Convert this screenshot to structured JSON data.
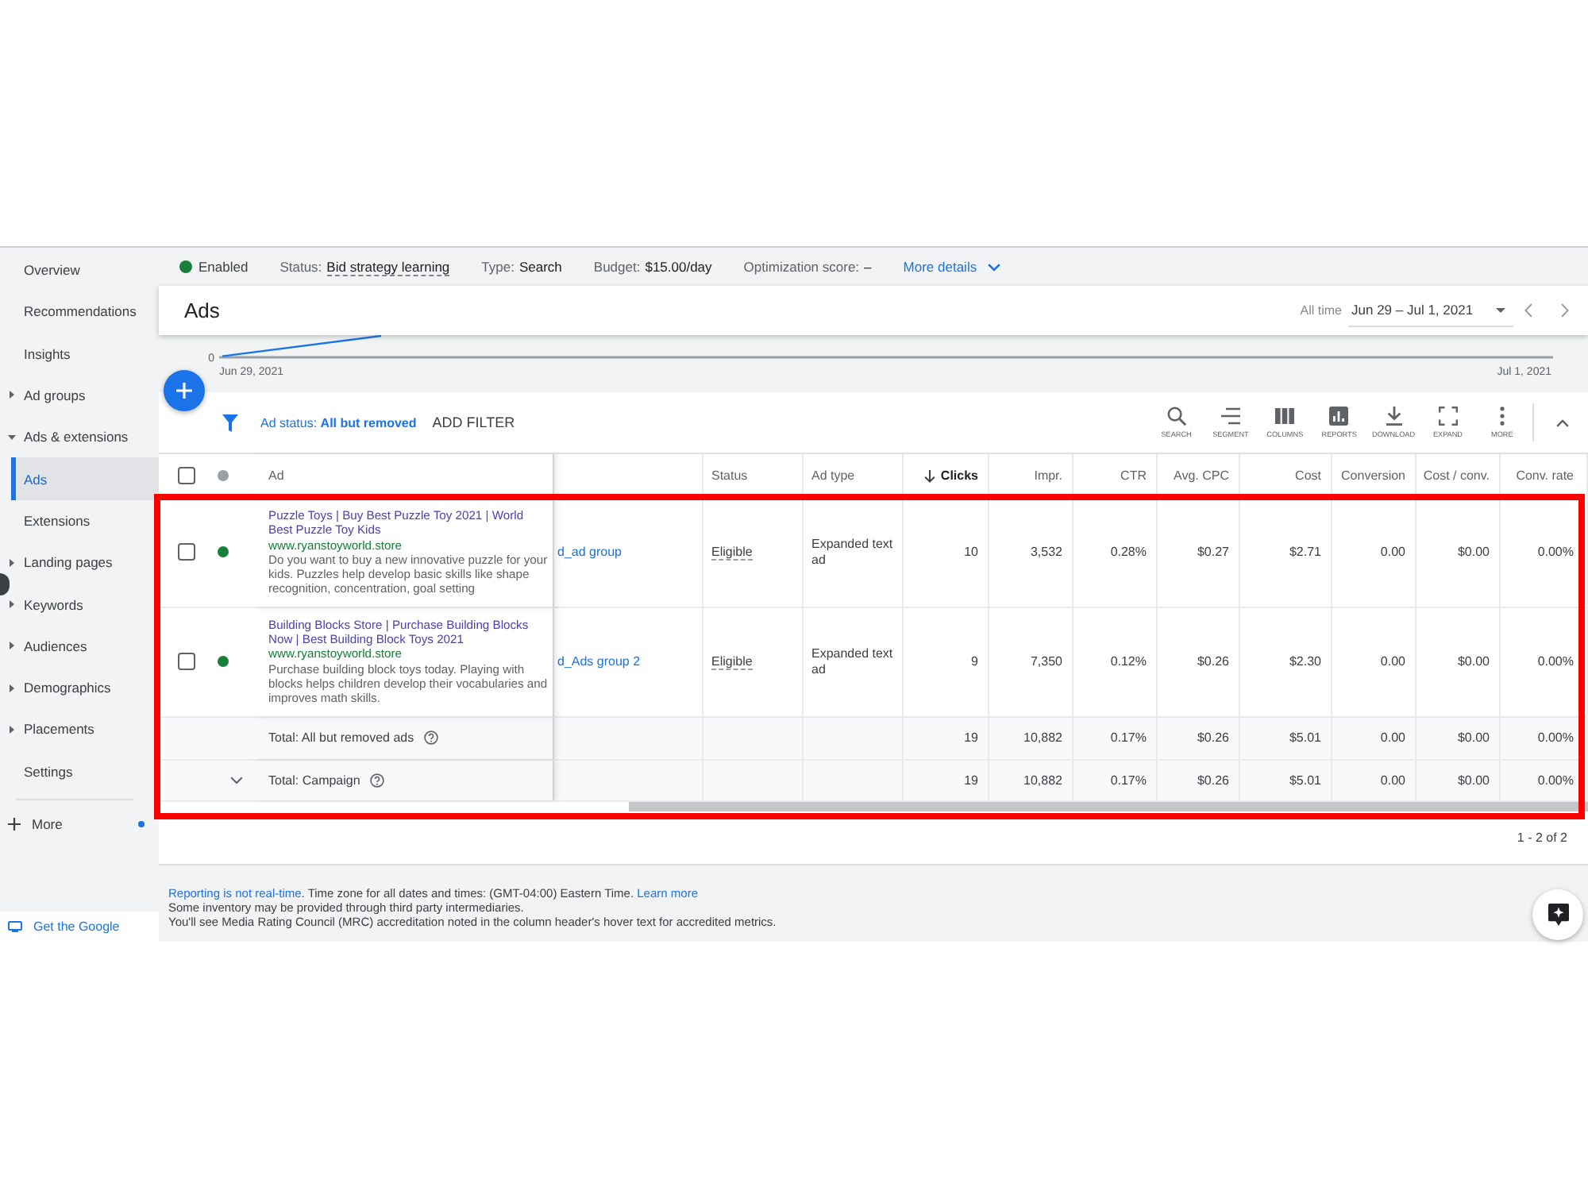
{
  "status_bar": {
    "items": [
      {
        "kind": "state",
        "label": "Enabled",
        "color": "#188038"
      },
      {
        "kind": "field",
        "label": "Status:",
        "value": "Bid strategy learning",
        "has_tooltip": true
      },
      {
        "kind": "field",
        "label": "Type:",
        "value": "Search",
        "has_tooltip": false
      },
      {
        "kind": "field",
        "label": "Budget:",
        "value": "$15.00/day",
        "has_tooltip": false
      },
      {
        "kind": "field",
        "label": "Optimization score:",
        "value": "–",
        "has_tooltip": false
      },
      {
        "kind": "link",
        "label": "More details"
      }
    ]
  },
  "sidebar": {
    "items": [
      {
        "label": "Overview",
        "kind": "page",
        "expanded": false,
        "selected": false
      },
      {
        "label": "Recommendations",
        "kind": "page",
        "expanded": false,
        "selected": false
      },
      {
        "label": "Insights",
        "kind": "page",
        "expanded": false,
        "selected": false
      },
      {
        "label": "Ad groups",
        "kind": "section",
        "expanded": false,
        "selected": false
      },
      {
        "label": "Ads & extensions",
        "kind": "section",
        "expanded": true,
        "selected": false,
        "children": [
          {
            "label": "Ads",
            "kind": "page",
            "expanded": false,
            "selected": true
          },
          {
            "label": "Extensions",
            "kind": "page",
            "expanded": false,
            "selected": false
          }
        ]
      },
      {
        "label": "Landing pages",
        "kind": "section",
        "expanded": false,
        "selected": false
      },
      {
        "label": "Keywords",
        "kind": "section",
        "expanded": false,
        "selected": false
      },
      {
        "label": "Audiences",
        "kind": "section",
        "expanded": false,
        "selected": false
      },
      {
        "label": "Demographics",
        "kind": "section",
        "expanded": false,
        "selected": false
      },
      {
        "label": "Placements",
        "kind": "section",
        "expanded": false,
        "selected": false
      },
      {
        "label": "Settings",
        "kind": "page",
        "expanded": false,
        "selected": false
      }
    ],
    "more": {
      "label": "More",
      "notification": true
    },
    "promo": {
      "label": "Get the Google"
    }
  },
  "page_header": {
    "title": "Ads",
    "date_preset": "All time",
    "date_range": "Jun 29 – Jul 1, 2021"
  },
  "chart": {
    "y_tick": "0",
    "start_label": "Jun 29, 2021",
    "end_label": "Jul 1, 2021"
  },
  "toolbar": {
    "filter": "Ad status: **All but removed**",
    "add_filter": "ADD FILTER",
    "tools": [
      {
        "kind": "search",
        "label": "SEARCH"
      },
      {
        "kind": "segment",
        "label": "SEGMENT"
      },
      {
        "kind": "columns",
        "label": "COLUMNS"
      },
      {
        "kind": "reports",
        "label": "REPORTS"
      },
      {
        "kind": "download",
        "label": "DOWNLOAD"
      },
      {
        "kind": "expand",
        "label": "EXPAND"
      },
      {
        "kind": "more",
        "label": "MORE"
      }
    ]
  },
  "table": {
    "header": {
      "checked": false,
      "ad": "Ad",
      "status": "Status",
      "ad_type": "Ad type",
      "metrics": [
        {
          "label": "Clicks",
          "sorted": true
        },
        {
          "label": "Impr.",
          "sorted": false
        },
        {
          "label": "CTR",
          "sorted": false
        },
        {
          "label": "Avg. CPC",
          "sorted": false
        },
        {
          "label": "Cost",
          "sorted": false
        },
        {
          "label": "Conversion",
          "sorted": false
        },
        {
          "label": "Cost / conv.",
          "sorted": false
        },
        {
          "label": "Conv. rate",
          "sorted": false
        }
      ]
    },
    "rows": [
      {
        "checked": false,
        "color": "#188038",
        "headline": "Puzzle Toys | Buy Best Puzzle Toy 2021 | World Best Puzzle Toy Kids",
        "url": "www.ryanstoyworld.store",
        "description": "Do you want to buy a new innovative puzzle for your kids. Puzzles help develop basic skills like shape recognition, concentration, goal setting",
        "column_2": "d_ad group",
        "status": "Eligible",
        "ad_type": "Expanded text ad",
        "metrics": [
          "10",
          "3,532",
          "0.28%",
          "$0.27",
          "$2.71",
          "0.00",
          "$0.00",
          "0.00%"
        ]
      },
      {
        "checked": false,
        "color": "#188038",
        "headline": "Building Blocks Store | Purchase Building Blocks Now | Best Building Block Toys 2021",
        "url": "www.ryanstoyworld.store",
        "description": "Purchase building block toys today. Playing with blocks helps children develop their vocabularies and improves math skills.",
        "column_2": "d_Ads group 2",
        "status": "Eligible",
        "ad_type": "Expanded text ad",
        "metrics": [
          "9",
          "7,350",
          "0.12%",
          "$0.26",
          "$2.30",
          "0.00",
          "$0.00",
          "0.00%"
        ]
      }
    ],
    "totals": [
      {
        "label": "Total: All but removed ads",
        "expandable": false,
        "metrics": [
          "19",
          "10,882",
          "0.17%",
          "$0.26",
          "$5.01",
          "0.00",
          "$0.00",
          "0.00%"
        ]
      },
      {
        "label": "Total: Campaign",
        "expandable": true,
        "metrics": [
          "19",
          "10,882",
          "0.17%",
          "$0.26",
          "$5.01",
          "0.00",
          "$0.00",
          "0.00%"
        ]
      }
    ],
    "pagination": "1 - 2 of 2"
  },
  "footer": {
    "lines": [
      {
        "parts": [
          {
            "kind": "link",
            "text": "Reporting is not real-time."
          },
          {
            "kind": "text",
            "text": "Time zone for all dates and times: (GMT-04:00) Eastern Time."
          },
          {
            "kind": "link",
            "text": "Learn more"
          }
        ]
      },
      {
        "parts": [
          {
            "kind": "text",
            "text": "Some inventory may be provided through third party intermediaries."
          }
        ]
      },
      {
        "parts": [
          {
            "kind": "text",
            "text": "You'll see Media Rating Council (MRC) accreditation noted in the column header's hover text for accredited metrics."
          }
        ]
      }
    ]
  },
  "annotation": {
    "kind": "rectangle"
  }
}
